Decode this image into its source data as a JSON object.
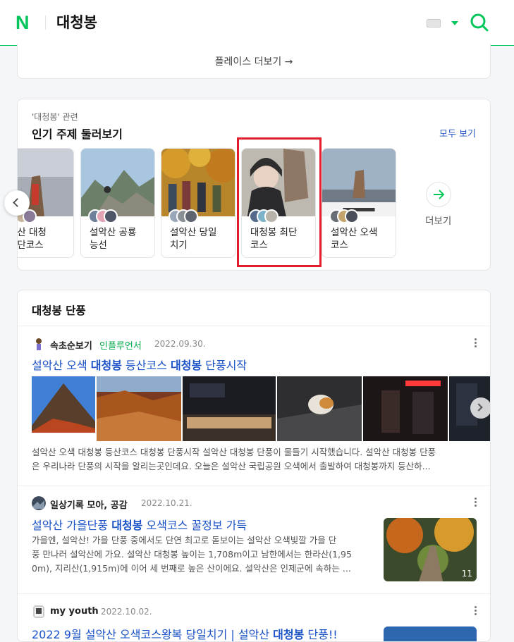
{
  "header": {
    "logo": "N",
    "query": "대청봉",
    "logo_color": "#03c75a"
  },
  "place": {
    "more_label": "플레이스 더보기 →"
  },
  "topics": {
    "subtitle": "'대청봉' 관련",
    "title": "인기 주제 둘러보기",
    "see_all": "모두 보기",
    "more_label": "더보기",
    "cards": [
      {
        "line1": "악산 대청",
        "line2": "최단코스"
      },
      {
        "line1": "설악산 공룡",
        "line2": "능선"
      },
      {
        "line1": "설악산 당일",
        "line2": "치기"
      },
      {
        "line1": "대청봉 최단",
        "line2": "코스"
      },
      {
        "line1": "설악산 오색",
        "line2": "코스"
      }
    ]
  },
  "autumn": {
    "title": "대청봉 단풍",
    "posts": [
      {
        "author": "속초순보기",
        "badge": "인플루언서",
        "date": "2022.09.30.",
        "title_parts": [
          "설악산 오색 ",
          "대청봉",
          " 등산코스 ",
          "대청봉",
          " 단풍시작"
        ],
        "desc_lines": [
          "설악산 오색 대청봉 등산코스 대청봉 단풍시작 설악산 대청봉 단풍이 물들기 시작했습니다. 설악산 대청봉 단풍",
          "은 우리나라 단풍의 시작을 알리는곳인데요. 오늘은 설악산 국립공원 오색에서 출발하여 대청봉까지 등산하..."
        ]
      },
      {
        "author": "일상기록 모아, 공감",
        "date": "2022.10.21.",
        "title_parts": [
          "설악산 가을단풍 ",
          "대청봉",
          " 오색코스 꿀정보 가득"
        ],
        "desc_lines": [
          "가을엔, 설악산! 가을 단풍 중에서도 단연 최고로 돋보이는 설악산 오색빛깔 가을 단",
          "풍 만나러 설악산에 가요. 설악산 대청봉 높이는 1,708m이고 남한에서는 한라산(1,95",
          "0m), 지리산(1,915m)에 이어 세 번째로 높은 산이에요. 설악산은 인제군에 속하는 ..."
        ],
        "thumb_count": "11"
      },
      {
        "author": "my youth",
        "date": "2022.10.02.",
        "title_parts": [
          "2022 9월 설악산 오색코스왕복 당일치기 | 설악산 ",
          "대청봉",
          " 단풍!!"
        ]
      }
    ]
  }
}
